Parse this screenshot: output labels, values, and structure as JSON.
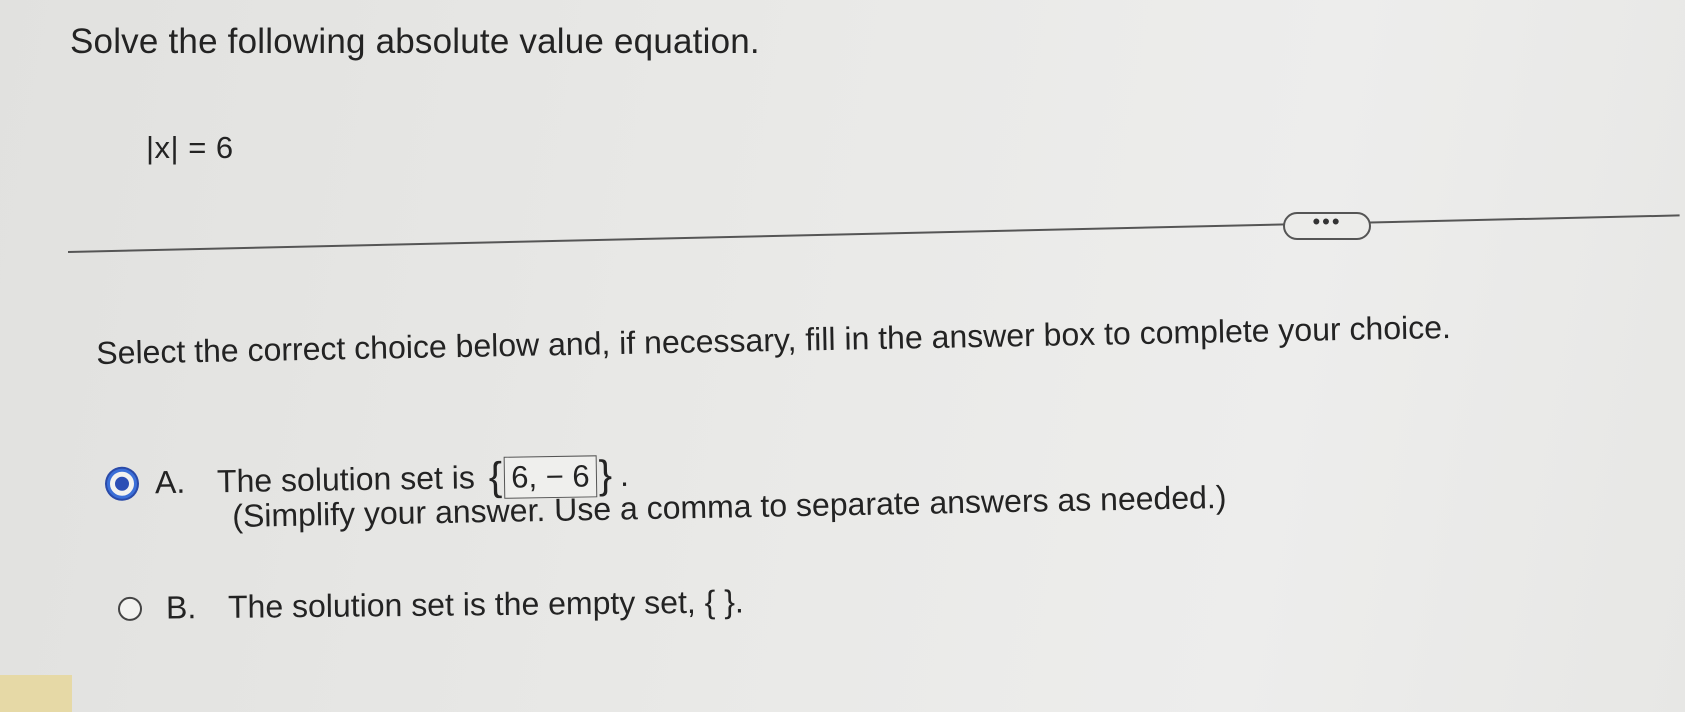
{
  "question": {
    "title": "Solve the following absolute value equation.",
    "equation": "|x| = 6"
  },
  "more_button": {
    "label": "•••"
  },
  "instructions": "Select the correct choice below and, if necessary, fill in the answer box to complete your choice.",
  "choices": [
    {
      "letter": "A.",
      "text_before": "The solution set is",
      "brace_open": "{",
      "answer_value": "6, − 6",
      "brace_close": "}",
      "text_after": ".",
      "hint": "(Simplify your answer. Use a comma to separate answers as needed.)",
      "selected": true
    },
    {
      "letter": "B.",
      "text": "The solution set is the empty set, { }.",
      "selected": false
    }
  ],
  "colors": {
    "radio_selected": "#2c4fb5",
    "background": "#e9e9e7"
  }
}
